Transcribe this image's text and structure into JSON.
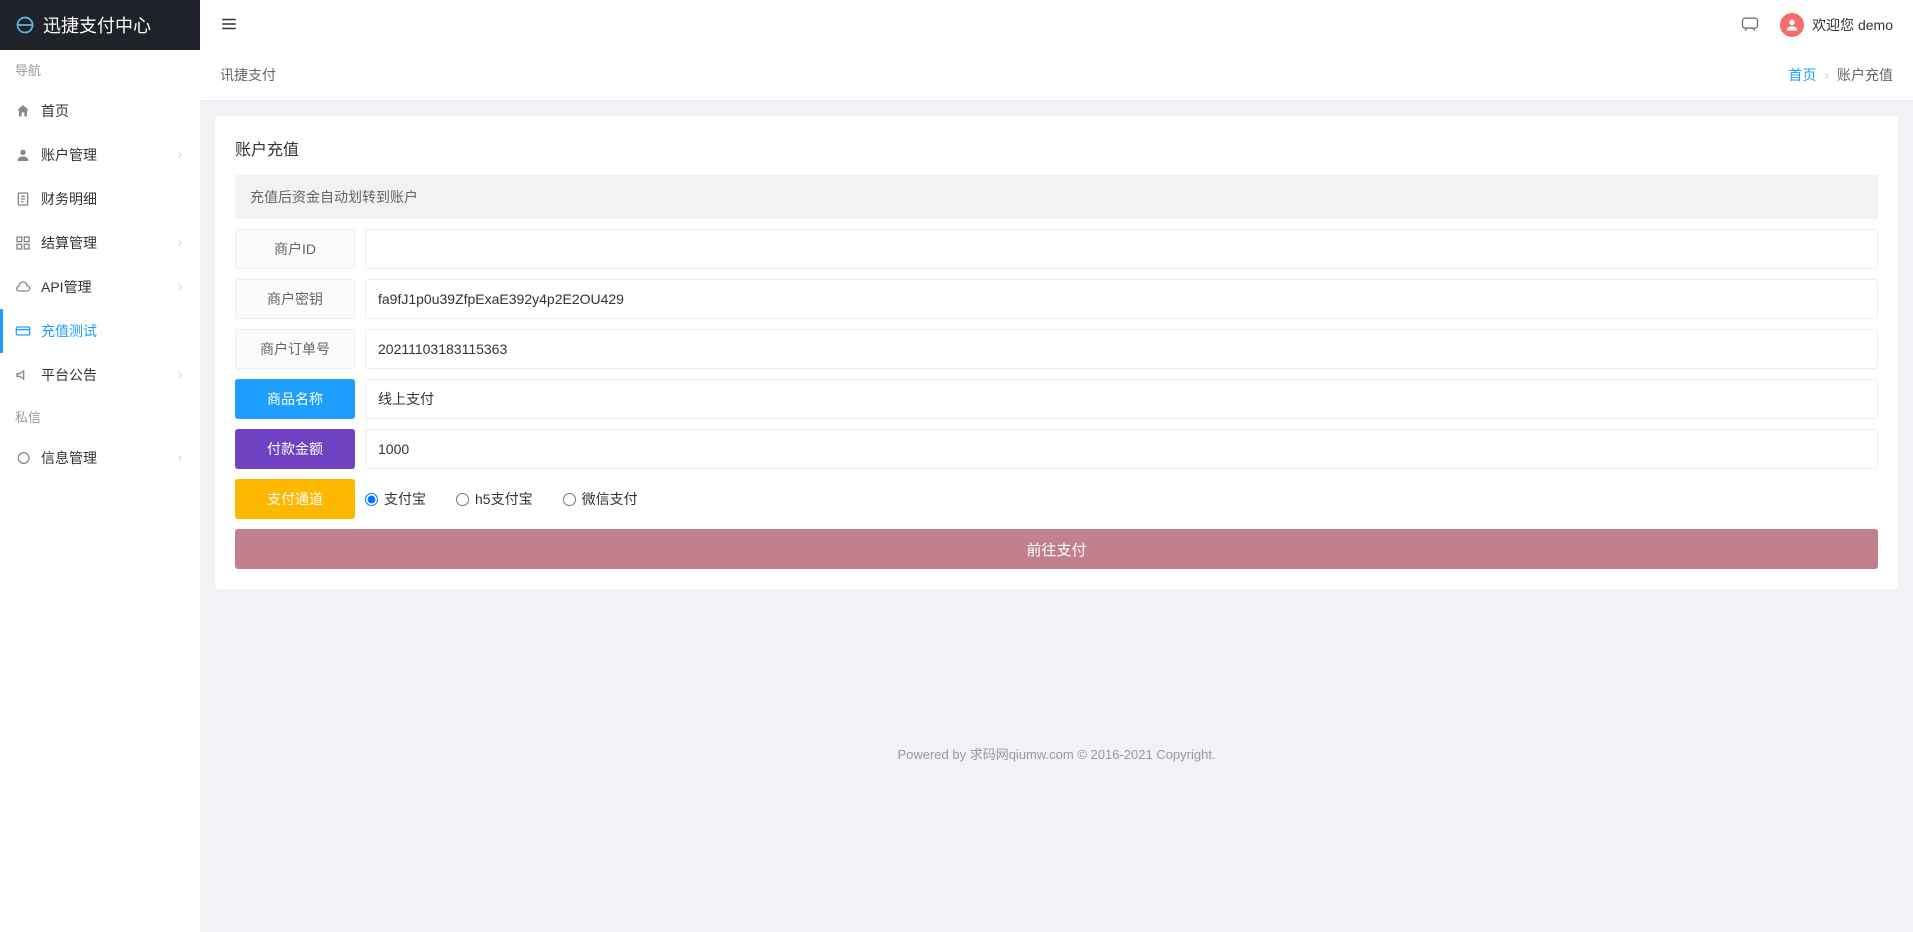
{
  "app": {
    "title": "迅捷支付中心"
  },
  "user": {
    "greeting": "欢迎您 demo"
  },
  "sidebar": {
    "sections": {
      "nav": "导航",
      "message": "私信"
    },
    "items": [
      {
        "label": "首页",
        "icon": "home",
        "expandable": false
      },
      {
        "label": "账户管理",
        "icon": "user",
        "expandable": true
      },
      {
        "label": "财务明细",
        "icon": "file",
        "expandable": false
      },
      {
        "label": "结算管理",
        "icon": "grid",
        "expandable": true
      },
      {
        "label": "API管理",
        "icon": "cloud",
        "expandable": true
      },
      {
        "label": "充值测试",
        "icon": "credit",
        "expandable": false,
        "active": true
      },
      {
        "label": "平台公告",
        "icon": "speaker",
        "expandable": true
      }
    ],
    "message_items": [
      {
        "label": "信息管理",
        "icon": "chat",
        "expandable": true
      }
    ]
  },
  "breadcrumb": {
    "left": "讯捷支付",
    "home": "首页",
    "current": "账户充值"
  },
  "page": {
    "title": "账户充值",
    "hint": "充值后资金自动划转到账户"
  },
  "form": {
    "merchant_id": {
      "label": "商户ID",
      "value": ""
    },
    "merchant_key": {
      "label": "商户密钥",
      "value": "fa9fJ1p0u39ZfpExaE392y4p2E2OU429"
    },
    "order_no": {
      "label": "商户订单号",
      "value": "20211103183115363"
    },
    "product_name": {
      "label": "商品名称",
      "value": "线上支付"
    },
    "amount": {
      "label": "付款金额",
      "value": "1000"
    },
    "channel": {
      "label": "支付通道",
      "options": [
        "支付宝",
        "h5支付宝",
        "微信支付"
      ],
      "selected": 0
    },
    "submit": "前往支付"
  },
  "footer": {
    "text": "Powered by 求码网qiumw.com © 2016-2021 Copyright."
  }
}
